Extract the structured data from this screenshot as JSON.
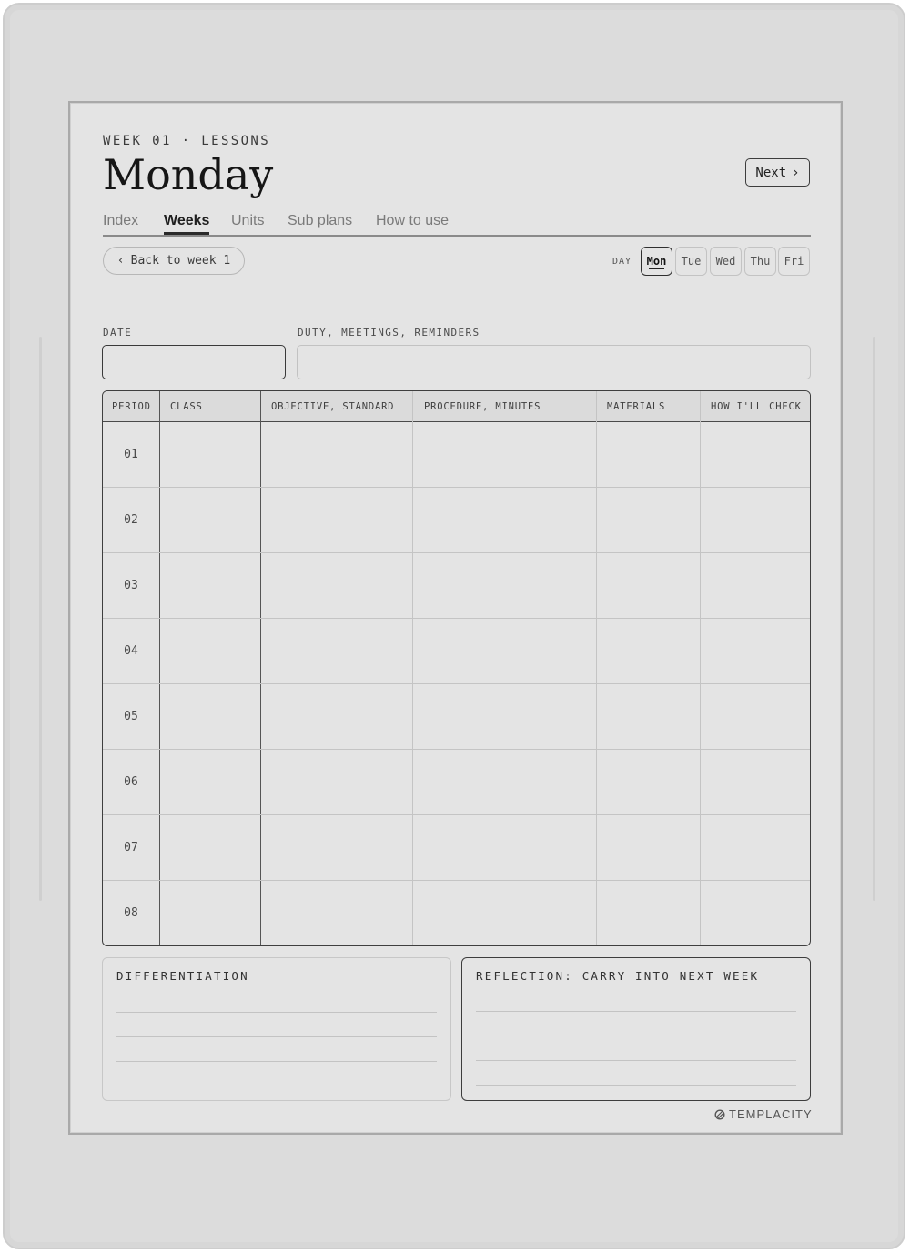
{
  "header": {
    "eyebrow": "WEEK 01 · LESSONS",
    "title": "Monday",
    "next_label": "Next",
    "next_icon": "›"
  },
  "tabs": [
    {
      "label": "Index",
      "active": false
    },
    {
      "label": "Weeks",
      "active": true
    },
    {
      "label": "Units",
      "active": false
    },
    {
      "label": "Sub plans",
      "active": false
    },
    {
      "label": "How to use",
      "active": false
    }
  ],
  "back": {
    "icon": "‹",
    "label": "Back to week 1"
  },
  "days": {
    "label": "DAY",
    "items": [
      "Mon",
      "Tue",
      "Wed",
      "Thu",
      "Fri"
    ],
    "selected": "Mon"
  },
  "fields": {
    "date_label": "DATE",
    "duty_label": "DUTY, MEETINGS, REMINDERS"
  },
  "table": {
    "columns": [
      "PERIOD",
      "CLASS",
      "OBJECTIVE, STANDARD",
      "PROCEDURE, MINUTES",
      "MATERIALS",
      "HOW I'LL CHECK"
    ],
    "periods": [
      "01",
      "02",
      "03",
      "04",
      "05",
      "06",
      "07",
      "08"
    ]
  },
  "cards": {
    "differentiation": "DIFFERENTIATION",
    "reflection": "REFLECTION: CARRY INTO NEXT WEEK"
  },
  "brand": {
    "name": "TEMPLACITY",
    "icon": "templacity-logo-icon"
  },
  "colors": {
    "ink": "#161616",
    "paper": "#e4e4e4",
    "bezel": "#dcdcdc",
    "rule": "#c4c4c4"
  }
}
